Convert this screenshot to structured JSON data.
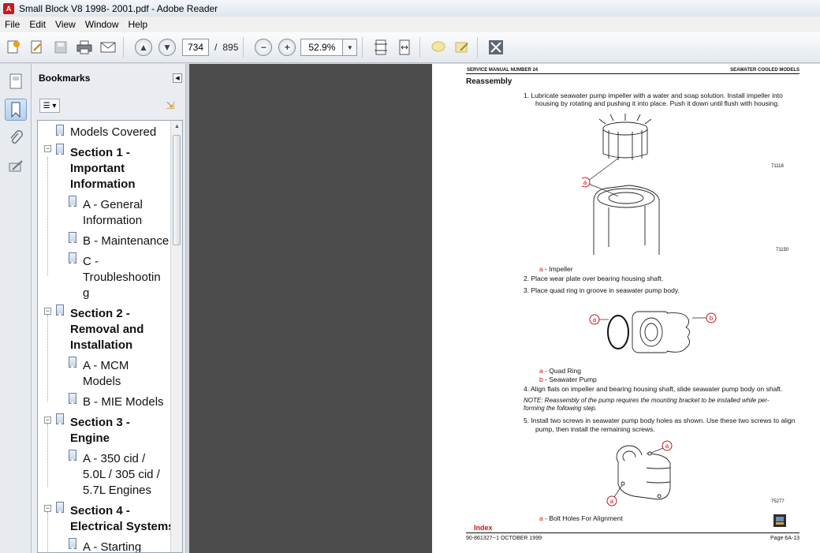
{
  "window": {
    "title": "Small Block V8 1998- 2001.pdf - Adobe Reader",
    "app_icon": "pdf-icon"
  },
  "menu": [
    "File",
    "Edit",
    "View",
    "Window",
    "Help"
  ],
  "toolbar": {
    "page_current": "734",
    "page_separator": "/",
    "page_total": "895",
    "zoom": "52.9%"
  },
  "sidebar": {
    "title": "Bookmarks",
    "items": [
      {
        "label": "Models Covered"
      },
      {
        "label": "Section 1 -"
      },
      {
        "label": "Important"
      },
      {
        "label": "Information"
      },
      {
        "label": "A - General"
      },
      {
        "label": "Information"
      },
      {
        "label": "B - Maintenance"
      },
      {
        "label": "C -"
      },
      {
        "label": "Troubleshootin"
      },
      {
        "label": "g"
      },
      {
        "label": "Section 2 -"
      },
      {
        "label": "Removal and"
      },
      {
        "label": "Installation"
      },
      {
        "label": "A - MCM"
      },
      {
        "label": "Models"
      },
      {
        "label": "B - MIE Models"
      },
      {
        "label": "Section 3 -"
      },
      {
        "label": "Engine"
      },
      {
        "label": "A - 350 cid /"
      },
      {
        "label": "5.0L / 305 cid /"
      },
      {
        "label": "5.7L Engines"
      },
      {
        "label": "Section 4 -"
      },
      {
        "label": "Electrical Systems"
      },
      {
        "label": "A - Starting"
      }
    ]
  },
  "document": {
    "header_left": "SERVICE MANUAL NUMBER 24",
    "header_right": "SEAWATER COOLED MODELS",
    "heading": "Reassembly",
    "step1_line1": "1.   Lubricate seawater pump impeller with a water and soap solution. Install impeller into",
    "step1_line2": "housing by rotating and pushing it into place. Push it down until flush with housing.",
    "fig1a": "71118",
    "fig1b": "71150",
    "legend1_key": "a",
    "legend1_text": "- Impeller",
    "step2": "2.   Place wear plate over bearing housing shaft.",
    "step3": "3.   Place quad ring in groove in seawater pump body.",
    "legend2a_key": "a",
    "legend2a_text": "- Quad Ring",
    "legend2b_key": "b",
    "legend2b_text": "- Seawater Pump",
    "step4": "4.   Align flats on impeller and bearing housing shaft, slide seawater pump body on shaft.",
    "note_line1": "NOTE: Reassembly of the pump requires the mounting bracket to be installed while per-",
    "note_line2": "forming the following step.",
    "step5_line1": "5.   Install two screws in seawater pump body holes as shown. Use these two screws to align",
    "step5_line2": "pump, then install the remaining screws.",
    "fig3": "75277",
    "legend3_key": "a",
    "legend3_text": "- Bolt Holes For Alignment",
    "index_link": "Index",
    "footer_left": "90-861327--1   OCTOBER 1999",
    "footer_right": "Page 6A-13",
    "callout_a": "a",
    "callout_b": "b"
  }
}
